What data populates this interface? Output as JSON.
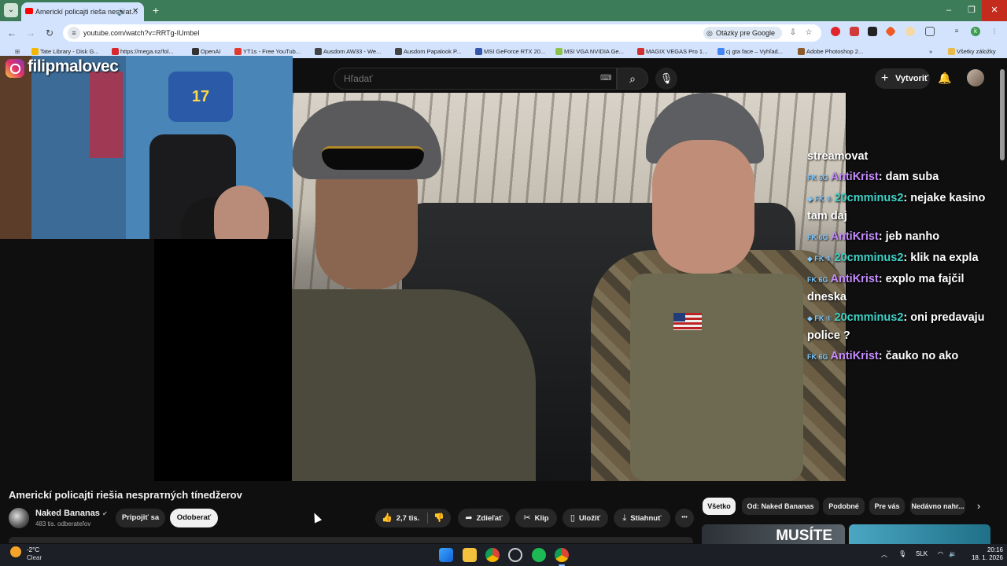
{
  "browser": {
    "tab_title": "Americkí policajti rieša nesprat...",
    "new_tab": "+",
    "url": "youtube.com/watch?v=RRTg-IUmbeI",
    "lens_chip": "Otázky pre Google",
    "window": {
      "minimize": "–",
      "restore": "❐",
      "close": "✕"
    },
    "bookmarks": [
      {
        "label": "Tate Library - Disk G...",
        "color": "#f2b600"
      },
      {
        "label": "https://mega.nz/fol...",
        "color": "#d9272e"
      },
      {
        "label": "OpenAI",
        "color": "#333333"
      },
      {
        "label": "YT1s - Free YouTub...",
        "color": "#e23b2e"
      },
      {
        "label": "Ausdom AW33 - We...",
        "color": "#444444"
      },
      {
        "label": "Ausdom Papalook P...",
        "color": "#444444"
      },
      {
        "label": "MSI GeForce RTX 20...",
        "color": "#3355aa"
      },
      {
        "label": "MSI VGA NVIDIA Ge...",
        "color": "#8bc34a"
      },
      {
        "label": "MAGIX VEGAS Pro 1...",
        "color": "#d03030"
      },
      {
        "label": "cj gta face – Vyhľad...",
        "color": "#4285f4"
      },
      {
        "label": "Adobe Photoshop 2...",
        "color": "#8a5a2a"
      }
    ],
    "bookmarks_more": "»",
    "all_bookmarks": "Všetky záložky"
  },
  "youtube": {
    "search_placeholder": "Hľadať",
    "create_label": "Vytvoriť",
    "video_title": "Americkí policajti riešia nesprатných tínedžerov",
    "channel": {
      "name": "Naked Bananas",
      "subscribers": "483 tis. odberateľov"
    },
    "join_label": "Pripojiť sa",
    "subscribe_label": "Odoberať",
    "like_count": "2,7 tis.",
    "share_label": "Zdieľať",
    "clip_label": "Klip",
    "save_label": "Uložiť",
    "download_label": "Stiahnuť",
    "more_label": "•••",
    "chips": [
      "Všetko",
      "Od: Naked Bananas",
      "Podobné",
      "Pre vás",
      "Nedávno nahr..."
    ],
    "thumb_text": "MUSÍTE"
  },
  "overlay": {
    "instagram_handle": "filipmalovec",
    "jersey_number": "17",
    "chat": [
      {
        "user": "",
        "message": "streamovat",
        "user_color": "#ffffff",
        "badges": ""
      },
      {
        "user": "AntiKrist",
        "message": ": dam suba",
        "user_color": "#c58cff",
        "badges": "FK 6G"
      },
      {
        "user": "20cmminus2",
        "message": ": nejake kasino tam daj",
        "user_color": "#3ed3c7",
        "badges": "◆ FK ①"
      },
      {
        "user": "AntiKrist",
        "message": ": jeb nanho",
        "user_color": "#c58cff",
        "badges": "FK 6G"
      },
      {
        "user": "20cmminus2",
        "message": ": klik na expla",
        "user_color": "#3ed3c7",
        "badges": "◆ FK ①"
      },
      {
        "user": "AntiKrist",
        "message": ": explo ma fajčil dneska",
        "user_color": "#c58cff",
        "badges": "FK 6G"
      },
      {
        "user": "20cmminus2",
        "message": ": oni predavaju police ?",
        "user_color": "#3ed3c7",
        "badges": "◆ FK ①"
      },
      {
        "user": "AntiKrist",
        "message": ": čauko no ako",
        "user_color": "#c58cff",
        "badges": "FK 6G"
      }
    ]
  },
  "taskbar": {
    "temperature": "-2°C",
    "condition": "Clear",
    "language": "SLK",
    "time": "20:16",
    "date": "18. 1. 2026"
  }
}
